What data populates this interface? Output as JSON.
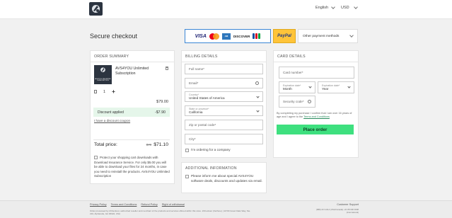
{
  "header": {
    "language": "English",
    "currency": "USD"
  },
  "page_title": "Secure checkout",
  "payment_methods": {
    "cards": [
      "VISA",
      "Mastercard",
      "American Express",
      "DISCOVER",
      "JCB"
    ],
    "paypal": "PayPal",
    "other": "Other payment methods"
  },
  "order_summary": {
    "heading": "ORDER SUMMARY",
    "product_box_text": "AVS4YOU UNLIMITED SUBSCRIPTION",
    "product_name": "AVS4YOU Unlimited Subscription",
    "quantity": "1",
    "price": "$79.00",
    "discount_label": "Discount applied",
    "discount_value": "-$7.90",
    "coupon_link": "I have a discount coupon",
    "total_label": "Total price:",
    "total_old": "$79",
    "total_new": "$71.10",
    "protection_text": "Protect your shopping cart downloads with Download Insurance Service. For only $5.00 you will be able to download your files for 24 months, in case you need to reinstall the products. AVS4YOU Unlimited Subscription"
  },
  "billing": {
    "heading": "BILLING DETAILS",
    "full_name_placeholder": "Full name*",
    "email_placeholder": "Email*",
    "country_label": "Country*",
    "country_value": "United States of America",
    "state_label": "State or province*",
    "state_value": "California",
    "zip_placeholder": "Zip or postal code*",
    "city_placeholder": "City*",
    "company_label": "I'm ordering for a company"
  },
  "additional": {
    "heading": "ADDITIONAL INFORMATION",
    "newsletter_label": "Please inform me about special AVS4YOU software deals, discounts and updates via email."
  },
  "card": {
    "heading": "CARD DETAILS",
    "card_number_placeholder": "Card number*",
    "exp_month_label": "Expiration date*",
    "exp_month_value": "Month",
    "exp_year_label": "Expiration date*",
    "exp_year_value": "Year",
    "security_placeholder": "Security code*",
    "terms_text": "By completing my purchase I confirm that I am over 16 years of age and I agree to the",
    "terms_link": "Terms and Conditions",
    "place_order": "Place order"
  },
  "footer": {
    "links": [
      "Privacy Policy",
      "Terms and Conditions",
      "Refund Policy",
      "Right of withdrawal"
    ],
    "note": "Order processed by 2Checkout, authorized reseller and merchant of the products and services offered within this store. 2Checkout (Verifone) | 11700 Great Oaks Way, Ste. 210, Alpharetta, GA 30022, USA",
    "support_label": "Customer Support",
    "phones": "(888) 247-1614 (USA/Canada) +31 88 000 0008 (International)"
  }
}
